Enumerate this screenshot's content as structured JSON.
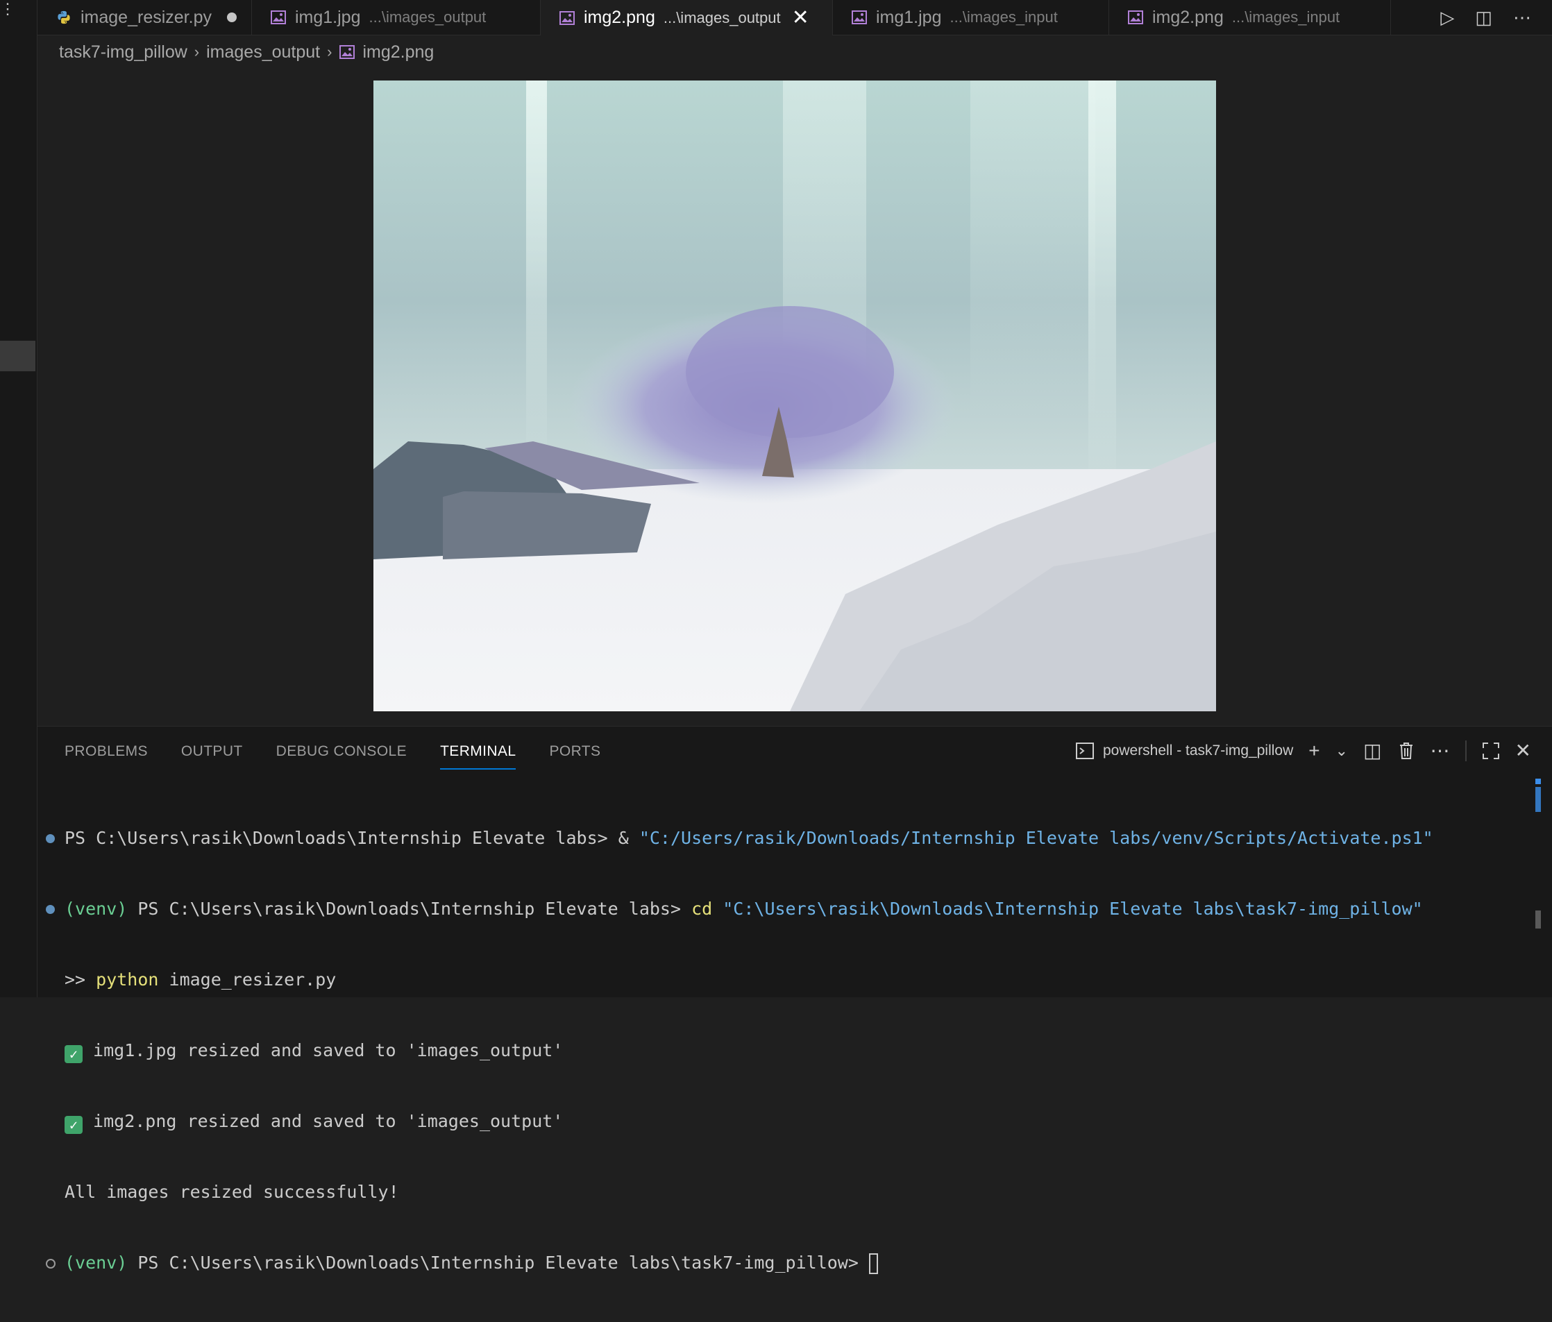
{
  "tabs": [
    {
      "label": "image_resizer.py",
      "description": "",
      "icon": "python-icon",
      "dirty": true,
      "active": false
    },
    {
      "label": "img1.jpg",
      "description": "...\\images_output",
      "icon": "image-file-icon",
      "active": false
    },
    {
      "label": "img2.png",
      "description": "...\\images_output",
      "icon": "image-file-icon",
      "active": true
    },
    {
      "label": "img1.jpg",
      "description": "...\\images_input",
      "icon": "image-file-icon",
      "active": false
    },
    {
      "label": "img2.png",
      "description": "...\\images_input",
      "icon": "image-file-icon",
      "active": false
    }
  ],
  "breadcrumb": [
    "task7-img_pillow",
    "images_output",
    "img2.png"
  ],
  "panel": {
    "tabs": [
      "PROBLEMS",
      "OUTPUT",
      "DEBUG CONSOLE",
      "TERMINAL",
      "PORTS"
    ],
    "active_tab": "TERMINAL",
    "terminal_name": "powershell - task7-img_pillow"
  },
  "terminal": {
    "line1_prompt": "PS C:\\Users\\rasik\\Downloads\\Internship Elevate labs> ",
    "line1_amp": "& ",
    "line1_path": "\"C:/Users/rasik/Downloads/Internship Elevate labs/venv/Scripts/Activate.ps1\"",
    "line2_venv": "(venv) ",
    "line2_prompt": "PS C:\\Users\\rasik\\Downloads\\Internship Elevate labs> ",
    "line2_cmd": "cd ",
    "line2_path": "\"C:\\Users\\rasik\\Downloads\\Internship Elevate labs\\task7-img_pillow\"",
    "line3_prefix": ">> ",
    "line3_cmd": "python",
    "line3_arg": " image_resizer.py",
    "line4": " img1.jpg resized and saved to 'images_output'",
    "line5": " img2.png resized and saved to 'images_output'",
    "line6": "All images resized successfully!",
    "line7_venv": "(venv) ",
    "line7_prompt": "PS C:\\Users\\rasik\\Downloads\\Internship Elevate labs\\task7-img_pillow> "
  },
  "colors": {
    "accent": "#0078d4",
    "terminal_green": "#6bcf94",
    "terminal_string": "#6fb3e6",
    "terminal_command": "#e5e07a"
  }
}
